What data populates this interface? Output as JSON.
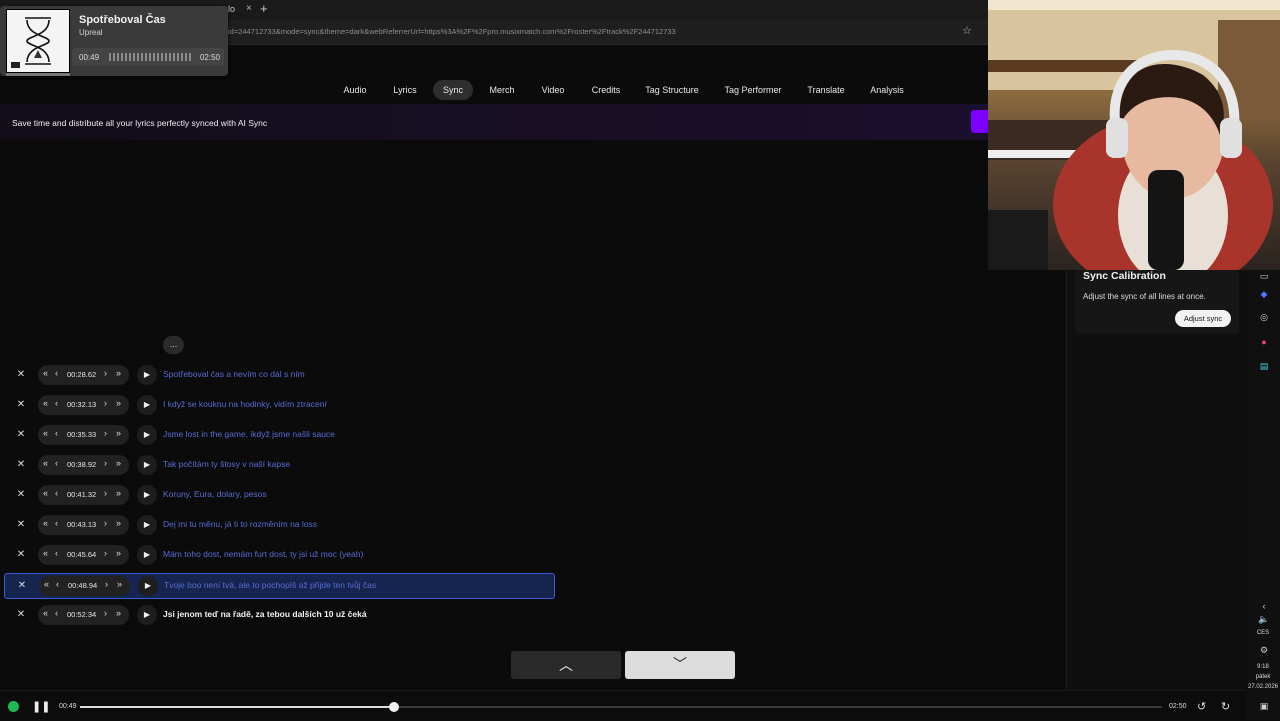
{
  "browser": {
    "tab_fragment": "lo",
    "new_tab": "+",
    "url": "id=244712733&mode=sync&theme=dark&webReferrerUrl=https%3A%2F%2Fpro.musixmatch.com%2Froster%2Ftrack%2F244712733"
  },
  "now_playing": {
    "title": "Spotřeboval Čas",
    "artist": "Upreal",
    "elapsed": "00:49",
    "duration": "02:50",
    "progress": 0.29
  },
  "nav_tabs": [
    "Audio",
    "Lyrics",
    "Sync",
    "Merch",
    "Video",
    "Credits",
    "Tag Structure",
    "Tag Performer",
    "Translate",
    "Analysis"
  ],
  "active_tab": "Sync",
  "banner": {
    "text": "Save time and distribute all your lyrics perfectly synced with AI Sync"
  },
  "sync": {
    "ellipsis": "...",
    "lines": [
      {
        "time": "00:28.62",
        "text": "Spotřeboval čas a nevím co dál s ním"
      },
      {
        "time": "00:32.13",
        "text": "I když se kouknu na hodinky, vidím ztracení"
      },
      {
        "time": "00:35.33",
        "text": "Jsme lost in the game, ikdyž jsme našli sauce"
      },
      {
        "time": "00:38.92",
        "text": "Tak počítám ty štosy v naší kapse"
      },
      {
        "time": "00:41.32",
        "text": "Koruny, Eura, dolary, pesos"
      },
      {
        "time": "00:43.13",
        "text": "Dej mi tu měnu, já ti to rozměním na loss"
      },
      {
        "time": "00:45.64",
        "text": "Mám toho dost, nemám furt dost, ty jsi už moc (yeah)"
      },
      {
        "time": "00:48.94",
        "text": "Tvoje boo není tvá, ale to pochopíš až přijde ten tvůj čas"
      },
      {
        "time": "00:52.34",
        "text": "Jsi jenom teď na řadě, za tebou dalších 10 už čeká"
      }
    ],
    "selected_index": 7,
    "current_index": 8
  },
  "calibration": {
    "title": "Sync Calibration",
    "description": "Adjust the sync of all lines at once.",
    "button": "Adjust sync"
  },
  "player": {
    "elapsed": "00:49",
    "duration": "02:50",
    "progress": 0.29
  },
  "tray": {
    "lang": "CES",
    "time": "9:18",
    "day": "pátek",
    "date": "27.02.2026"
  }
}
